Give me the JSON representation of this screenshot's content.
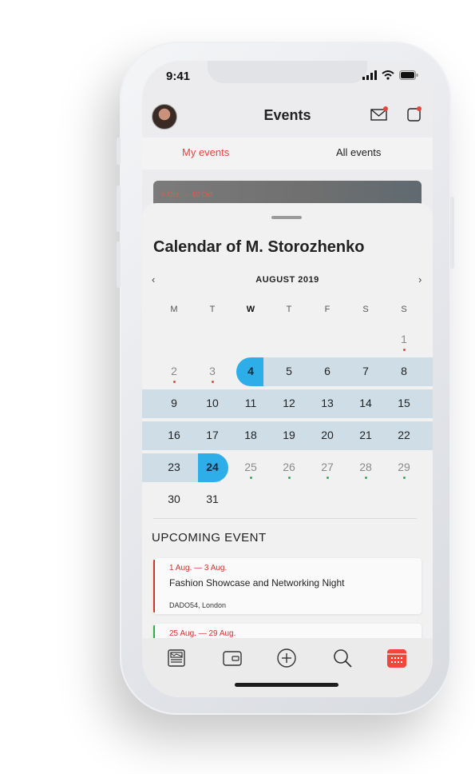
{
  "status_bar": {
    "time": "9:41"
  },
  "header": {
    "title": "Events"
  },
  "tabs": [
    {
      "label": "My events",
      "active": true
    },
    {
      "label": "All events",
      "active": false
    }
  ],
  "background_card": {
    "date": "6 Oct. — 10 Oct."
  },
  "calendar": {
    "title": "Calendar of M. Storozhenko",
    "month": "AUGUST 2019",
    "weekdays": [
      "M",
      "T",
      "W",
      "T",
      "F",
      "S",
      "S"
    ],
    "days": [
      "1",
      "2",
      "3",
      "4",
      "5",
      "6",
      "7",
      "8",
      "9",
      "10",
      "11",
      "12",
      "13",
      "14",
      "15",
      "16",
      "17",
      "18",
      "19",
      "20",
      "21",
      "22",
      "23",
      "24",
      "25",
      "26",
      "27",
      "28",
      "29",
      "30",
      "31"
    ],
    "selected_start": "4",
    "selected_end": "24"
  },
  "upcoming": {
    "heading": "UPCOMING EVENT",
    "events": [
      {
        "dates": "1 Aug. — 3 Aug.",
        "name": "Fashion Showcase and Networking Night",
        "location": "DADO54, London",
        "accent": "#d0332b"
      },
      {
        "dates": "25 Aug. — 29 Aug.",
        "accent": "#2fae4a"
      }
    ]
  },
  "colors": {
    "accent": "#e8453c",
    "selected": "#2eaee8",
    "range": "#cfdde6",
    "event_dot_red": "#e8453c",
    "event_dot_green": "#2fae4a"
  },
  "nav": {
    "items": [
      "news-icon",
      "wallet-icon",
      "add-icon",
      "search-icon",
      "calendar-icon"
    ],
    "active": "calendar-icon"
  }
}
